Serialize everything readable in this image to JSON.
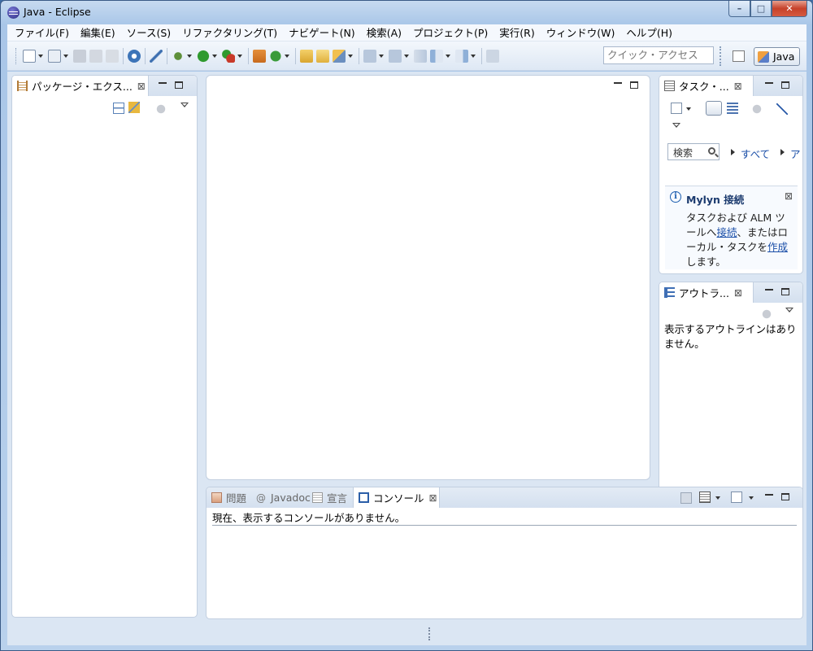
{
  "window": {
    "title": "Java - Eclipse",
    "minimize_label": "–",
    "maximize_label": "□",
    "close_label": "✕"
  },
  "menu": [
    "ファイル(F)",
    "編集(E)",
    "ソース(S)",
    "リファクタリング(T)",
    "ナビゲート(N)",
    "検索(A)",
    "プロジェクト(P)",
    "実行(R)",
    "ウィンドウ(W)",
    "ヘルプ(H)"
  ],
  "toolbar": {
    "quick_access_placeholder": "クイック・アクセス",
    "perspective": "Java"
  },
  "package_explorer": {
    "tab_label": "パッケージ・エクス...",
    "close_label": "⊠"
  },
  "tasks": {
    "tab_label": "タスク・...",
    "close_label": "⊠",
    "search_placeholder": "検索",
    "filter_all": "すべて",
    "filter_next": "ア",
    "mylyn": {
      "title": "Mylyn 接続",
      "close_label": "⊠",
      "info_glyph": "i",
      "text_prefix": "タスクおよび ALM ツールへ",
      "link_connect": "接続",
      "text_middle": "、またはローカル・タスクを",
      "link_create": "作成",
      "text_suffix": "します。"
    }
  },
  "outline": {
    "tab_label": "アウトラ...",
    "close_label": "⊠",
    "message": "表示するアウトラインはありません。"
  },
  "bottom_panel": {
    "tabs": [
      {
        "label": "問題"
      },
      {
        "label": "Javadoc"
      },
      {
        "label": "宣言"
      },
      {
        "label": "コンソール",
        "active": true
      }
    ],
    "close_label": "⊠",
    "console_message": "現在、表示するコンソールがありません。"
  },
  "colors": {
    "accent": "#1b4fa8",
    "frame": "#3a5a86",
    "workbench": "#dbe6f3"
  }
}
